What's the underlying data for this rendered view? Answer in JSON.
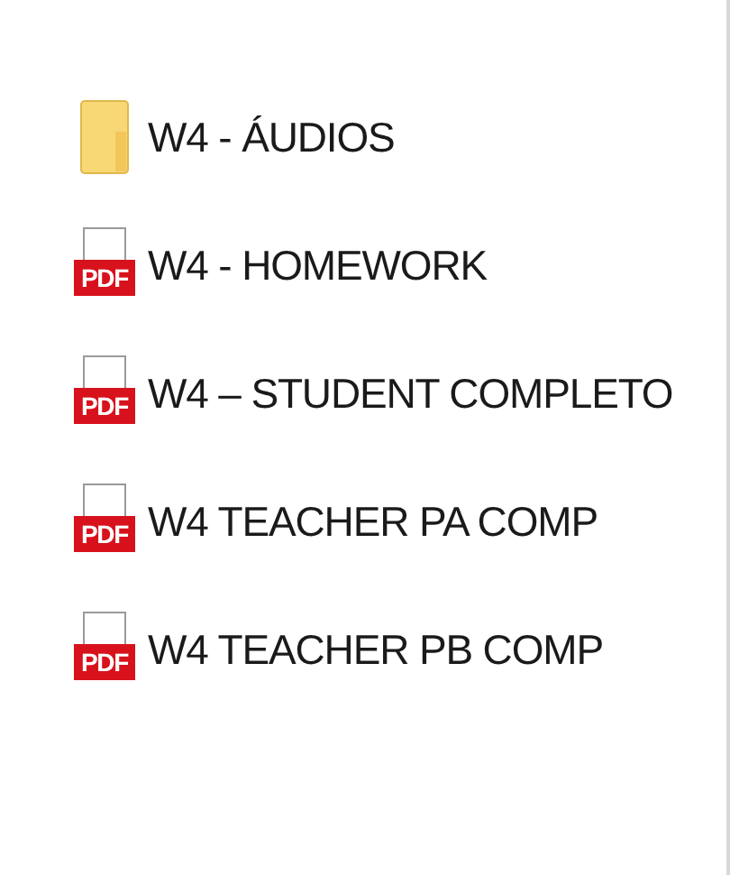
{
  "files": [
    {
      "kind": "folder",
      "name": "W4 - ÁUDIOS"
    },
    {
      "kind": "pdf",
      "name": "W4 - HOMEWORK",
      "icon_label": "PDF"
    },
    {
      "kind": "pdf",
      "name": "W4 – STUDENT COMPLETO",
      "icon_label": "PDF"
    },
    {
      "kind": "pdf",
      "name": "W4 TEACHER PA COMP",
      "icon_label": "PDF"
    },
    {
      "kind": "pdf",
      "name": "W4 TEACHER PB COMP",
      "icon_label": "PDF"
    }
  ]
}
